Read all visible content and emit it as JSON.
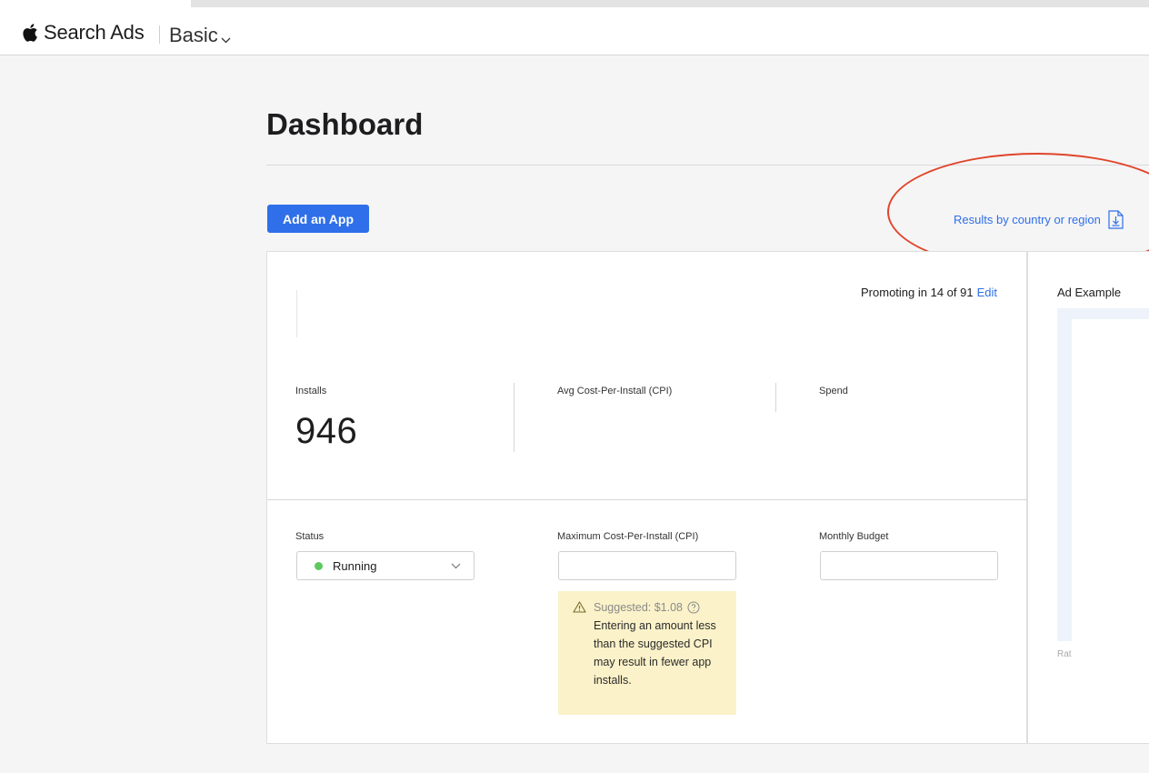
{
  "header": {
    "brand": "Search Ads",
    "plan": "Basic"
  },
  "page": {
    "title": "Dashboard",
    "add_app_label": "Add an App",
    "results_link": "Results by country or region"
  },
  "app_card": {
    "promoting_text": "Promoting in 14 of 91",
    "edit_label": "Edit",
    "metrics": {
      "installs_label": "Installs",
      "installs_value": "946",
      "cpi_label": "Avg Cost-Per-Install (CPI)",
      "spend_label": "Spend"
    },
    "settings": {
      "status_label": "Status",
      "status_value": "Running",
      "status_color": "#5fc95f",
      "max_cpi_label": "Maximum Cost-Per-Install (CPI)",
      "max_cpi_value": "",
      "budget_label": "Monthly Budget",
      "budget_value": ""
    },
    "warning": {
      "suggested": "Suggested: $1.08",
      "message": "Entering an amount less than the suggested CPI may result in fewer app installs."
    }
  },
  "ad_panel": {
    "title": "Ad Example",
    "footer": "Rat"
  },
  "colors": {
    "accent": "#2f6fe9",
    "highlight_circle": "#e0452b",
    "warning_bg": "#fbf2c9"
  }
}
